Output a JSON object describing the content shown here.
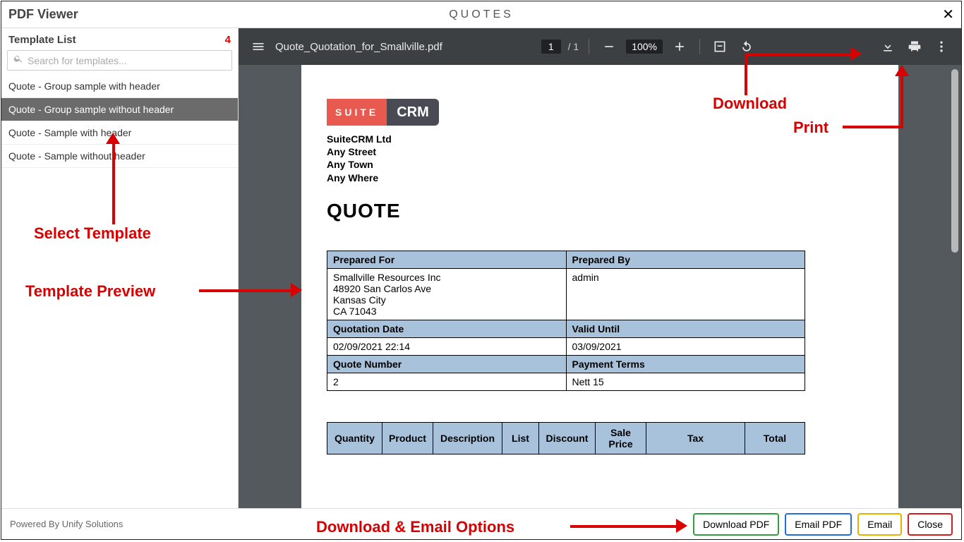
{
  "titlebar": {
    "app_title": "PDF Viewer",
    "doc_title": "QUOTES",
    "close": "✕"
  },
  "sidebar": {
    "heading": "Template List",
    "count": "4",
    "search_placeholder": "Search for templates...",
    "items": [
      {
        "label": "Quote - Group sample with header"
      },
      {
        "label": "Quote - Group sample without header"
      },
      {
        "label": "Quote - Sample with header"
      },
      {
        "label": "Quote - Sample without header"
      }
    ],
    "selected_index": 1
  },
  "toolbar": {
    "filename": "Quote_Quotation_for_Smallville.pdf",
    "page_current": "1",
    "page_total": "/ 1",
    "zoom": "100%"
  },
  "pdf": {
    "logo_left": "SUITE",
    "logo_right": "CRM",
    "company_lines": [
      "SuiteCRM Ltd",
      "Any Street",
      "Any Town",
      "Any Where"
    ],
    "heading": "QUOTE",
    "meta": {
      "prepared_for_h": "Prepared For",
      "prepared_by_h": "Prepared By",
      "prepared_for_v": "Smallville Resources Inc\n48920 San Carlos Ave\nKansas City\nCA 71043",
      "prepared_by_v": "admin",
      "quotation_date_h": "Quotation Date",
      "valid_until_h": "Valid Until",
      "quotation_date_v": "02/09/2021 22:14",
      "valid_until_v": "03/09/2021",
      "quote_number_h": "Quote Number",
      "payment_terms_h": "Payment Terms",
      "quote_number_v": "2",
      "payment_terms_v": "Nett 15"
    },
    "items_headers": [
      "Quantity",
      "Product",
      "Description",
      "List",
      "Discount",
      "Sale Price",
      "Tax",
      "Total"
    ]
  },
  "footer": {
    "credit": "Powered By Unify Solutions",
    "buttons": {
      "download_pdf": "Download PDF",
      "email_pdf": "Email PDF",
      "email": "Email",
      "close": "Close"
    }
  },
  "annotations": {
    "select_template": "Select Template",
    "template_preview": "Template Preview",
    "download": "Download",
    "print": "Print",
    "download_email": "Download & Email Options"
  }
}
